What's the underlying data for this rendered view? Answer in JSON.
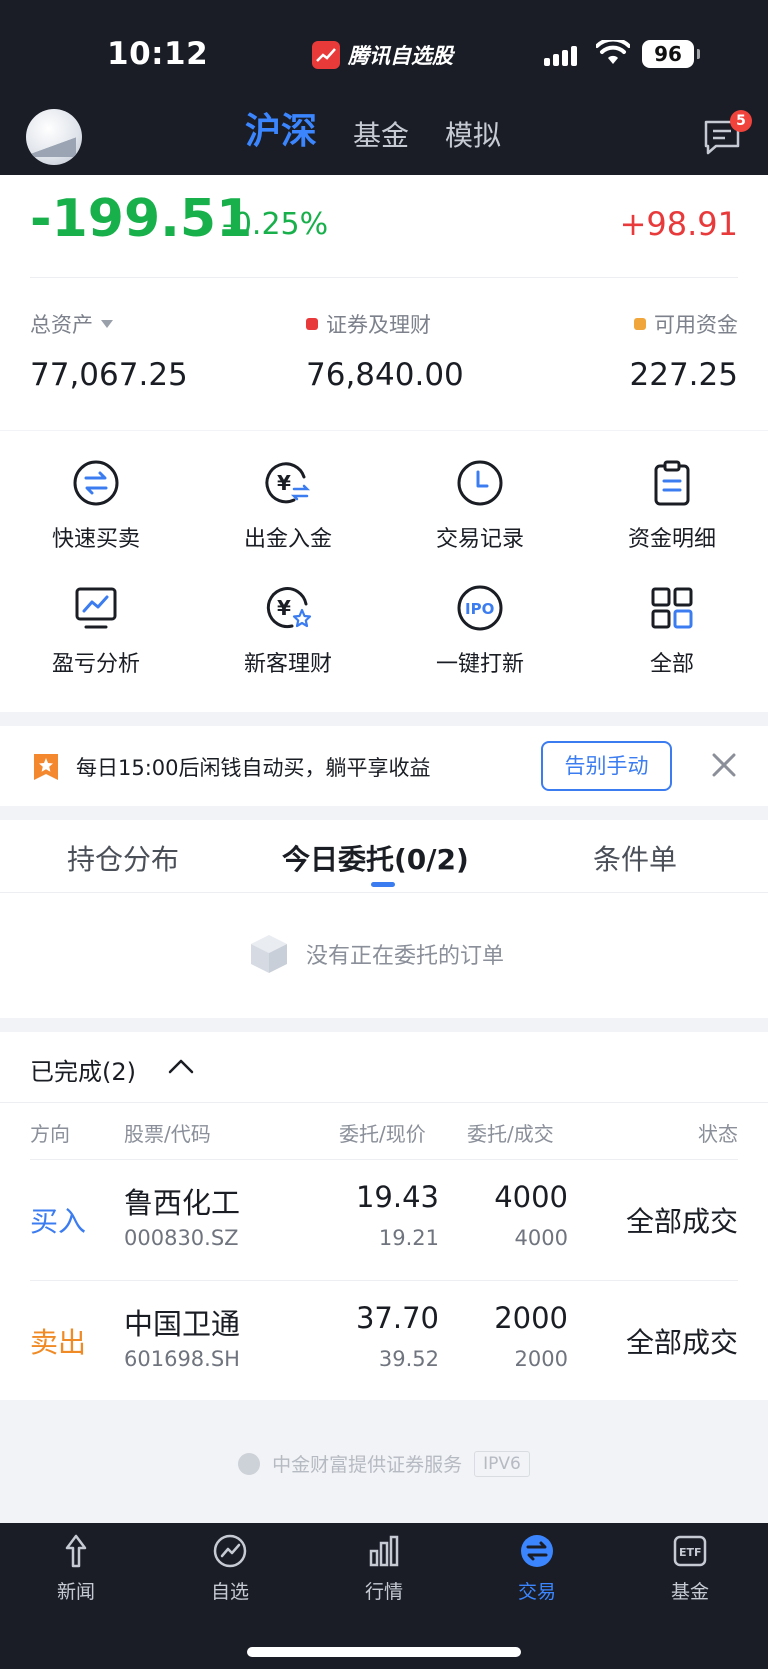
{
  "status_bar": {
    "time": "10:12",
    "app_name": "腾讯自选股",
    "battery": "96"
  },
  "header": {
    "tabs": [
      {
        "label": "沪深",
        "active": true
      },
      {
        "label": "基金",
        "active": false
      },
      {
        "label": "模拟",
        "active": false
      }
    ],
    "message_badge": "5"
  },
  "summary": {
    "day_pnl": "-199.51",
    "day_pct": "-0.25%",
    "right_value": "+98.91",
    "total_assets_label": "总资产",
    "total_assets": "77,067.25",
    "securities_label": "证券及理财",
    "securities": "76,840.00",
    "cash_label": "可用资金",
    "cash": "227.25",
    "colors": {
      "down": "#18b04b",
      "up": "#e8393b",
      "securities_dot": "#e8393b",
      "cash_dot": "#f0a63a"
    }
  },
  "grid": [
    {
      "label": "快速买卖",
      "icon": "swap-icon"
    },
    {
      "label": "出金入金",
      "icon": "yuan-transfer-icon"
    },
    {
      "label": "交易记录",
      "icon": "clock-icon"
    },
    {
      "label": "资金明细",
      "icon": "clipboard-icon"
    },
    {
      "label": "盈亏分析",
      "icon": "monitor-chart-icon"
    },
    {
      "label": "新客理财",
      "icon": "yuan-star-icon"
    },
    {
      "label": "一键打新",
      "icon": "ipo-icon"
    },
    {
      "label": "全部",
      "icon": "grid-icon"
    }
  ],
  "banner": {
    "text": "每日15:00后闲钱自动买，躺平享收益",
    "button": "告别手动"
  },
  "orders": {
    "tabs": [
      "持仓分布",
      "今日委托(0/2)",
      "条件单"
    ],
    "active_tab": 1,
    "empty_text": "没有正在委托的订单"
  },
  "completed": {
    "title": "已完成(2)",
    "headers": [
      "方向",
      "股票/代码",
      "委托/现价",
      "委托/成交",
      "状态"
    ],
    "rows": [
      {
        "direction": "买入",
        "name": "鲁西化工",
        "code": "000830.SZ",
        "order_price": "19.43",
        "current_price": "19.21",
        "order_qty": "4000",
        "filled_qty": "4000",
        "status": "全部成交",
        "dir_color": "#3b7cf0"
      },
      {
        "direction": "卖出",
        "name": "中国卫通",
        "code": "601698.SH",
        "order_price": "37.70",
        "current_price": "39.52",
        "order_qty": "2000",
        "filled_qty": "2000",
        "status": "全部成交",
        "dir_color": "#f08a24"
      }
    ]
  },
  "footer": {
    "text": "中金财富提供证券服务",
    "tag": "IPV6"
  },
  "bottom_nav": [
    {
      "label": "新闻",
      "icon": "news-icon",
      "active": false
    },
    {
      "label": "自选",
      "icon": "watchlist-icon",
      "active": false
    },
    {
      "label": "行情",
      "icon": "market-icon",
      "active": false
    },
    {
      "label": "交易",
      "icon": "trade-icon",
      "active": true
    },
    {
      "label": "基金",
      "icon": "etf-icon",
      "active": false
    }
  ]
}
